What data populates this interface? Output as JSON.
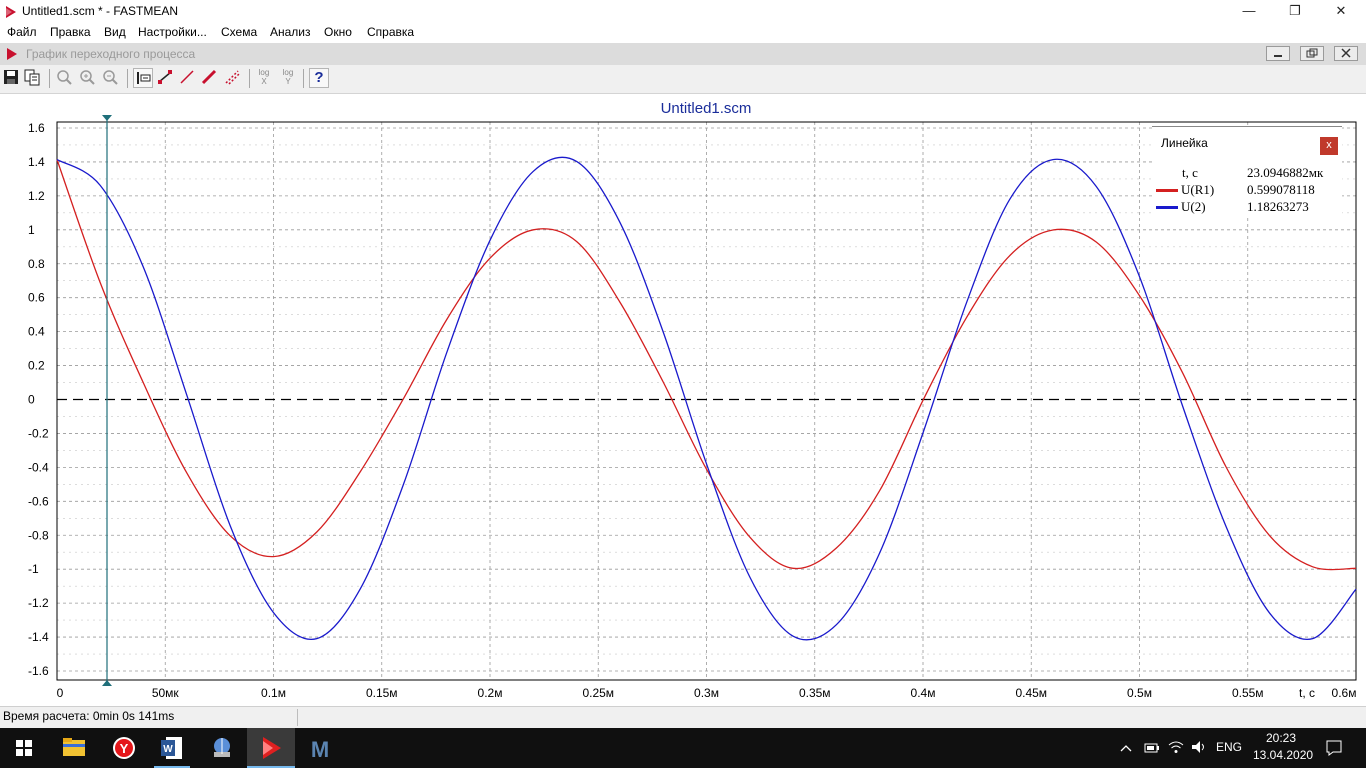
{
  "app": {
    "window_title": "Untitled1.scm * - FASTMEAN",
    "window_buttons": [
      "—",
      "❐",
      "✕"
    ]
  },
  "menu": [
    "Файл",
    "Правка",
    "Вид",
    "Настройки...",
    "Схема",
    "Анализ",
    "Окно",
    "Справка"
  ],
  "child_window": {
    "title": "График переходного процесса"
  },
  "toolbar": {
    "log_x_top": "log",
    "log_x_bottom": "X",
    "log_y_top": "log",
    "log_y_bottom": "Y",
    "help_label": "?"
  },
  "chart_data": {
    "type": "line",
    "title": "Untitled1.scm",
    "xlabel": "t, c",
    "xlim": [
      0,
      0.0006
    ],
    "ylim": [
      -1.6,
      1.6
    ],
    "x_ticks": [
      0,
      5e-05,
      0.0001,
      0.00015,
      0.0002,
      0.00025,
      0.0003,
      0.00035,
      0.0004,
      0.00045,
      0.0005,
      0.00055,
      0.0006
    ],
    "x_tick_labels": [
      "0",
      "50мк",
      "0.1м",
      "0.15м",
      "0.2м",
      "0.25м",
      "0.3м",
      "0.35м",
      "0.4м",
      "0.45м",
      "0.5м",
      "0.55м",
      "0.6м"
    ],
    "y_ticks": [
      1.6,
      1.4,
      1.2,
      1,
      0.8,
      0.6,
      0.4,
      0.2,
      0,
      -0.2,
      -0.4,
      -0.6,
      -0.8,
      -1,
      -1.2,
      -1.4,
      -1.6
    ],
    "y_tick_labels": [
      "1.6",
      "1.4",
      "1.2",
      "1",
      "0.8",
      "0.6",
      "0.4",
      "0.2",
      "0",
      "-0.2",
      "-0.4",
      "-0.6",
      "-0.8",
      "-1",
      "-1.2",
      "-1.4",
      "-1.6"
    ],
    "grid": true,
    "cursor_x": 2.30946882e-05,
    "series": [
      {
        "name": "U(R1)",
        "color": "#d42020",
        "x": [
          0,
          2e-05,
          4e-05,
          6e-05,
          8e-05,
          0.0001,
          0.00012,
          0.00014,
          0.00016,
          0.00018,
          0.0002,
          0.00022,
          0.00024,
          0.00026,
          0.00028,
          0.0003,
          0.00032,
          0.00034,
          0.00036,
          0.00038,
          0.0004,
          0.00042,
          0.00044,
          0.00046,
          0.00048,
          0.0005,
          0.00052,
          0.00054,
          0.00056,
          0.00058,
          0.0006
        ],
        "values": [
          1.414,
          0.687,
          0.095,
          -0.434,
          -0.803,
          -0.926,
          -0.781,
          -0.427,
          0.004,
          0.471,
          0.833,
          1.0,
          0.931,
          0.574,
          0.103,
          -0.411,
          -0.811,
          -0.995,
          -0.875,
          -0.537,
          -0.005,
          0.481,
          0.847,
          0.999,
          0.928,
          0.612,
          0.155,
          -0.398,
          -0.801,
          -0.986,
          -0.995
        ]
      },
      {
        "name": "U(2)",
        "color": "#1a1acc",
        "x": [
          0,
          2e-05,
          4e-05,
          6e-05,
          8e-05,
          0.0001,
          0.00012,
          0.00014,
          0.00016,
          0.00018,
          0.0002,
          0.00022,
          0.00024,
          0.00026,
          0.00028,
          0.0003,
          0.00032,
          0.00034,
          0.00036,
          0.00038,
          0.0004,
          0.00042,
          0.00044,
          0.00046,
          0.00048,
          0.0005,
          0.00052,
          0.00054,
          0.00056,
          0.00058,
          0.0006
        ],
        "values": [
          1.414,
          1.261,
          0.776,
          0.024,
          -0.744,
          -1.256,
          -1.409,
          -1.118,
          -0.501,
          0.276,
          0.938,
          1.345,
          1.403,
          1.044,
          0.398,
          -0.379,
          -1.046,
          -1.395,
          -1.327,
          -0.904,
          -0.197,
          0.567,
          1.178,
          1.414,
          1.256,
          0.724,
          -0.042,
          -0.749,
          -1.257,
          -1.409,
          -1.118
        ]
      }
    ]
  },
  "ruler": {
    "title": "Линейка",
    "close_label": "x",
    "t_label": "t, c",
    "t_value": "23.0946882мк",
    "rows": [
      {
        "name": "U(R1)",
        "value": "0.599078118",
        "color": "#d42020"
      },
      {
        "name": "U(2)",
        "value": "1.18263273",
        "color": "#1a1acc"
      }
    ]
  },
  "status": {
    "calc_time": "Время расчета: 0min 0s 141ms"
  },
  "taskbar": {
    "apps": [
      "start-icon",
      "file-explorer-icon",
      "yandex-browser-icon",
      "word-icon",
      "network-tool-icon",
      "fastmean-icon",
      "mathcad-icon"
    ],
    "language": "ENG",
    "time": "20:23",
    "date": "13.04.2020"
  }
}
